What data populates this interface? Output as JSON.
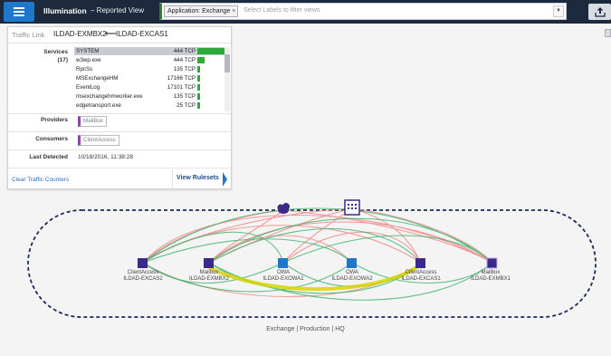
{
  "header": {
    "app_title": "Illumination",
    "view_title": "–  Reported View",
    "filter_chip": "Application: Exchange",
    "filter_chip_close": "×",
    "filter_placeholder": "Select Labels to filter views",
    "dropdown_glyph": "▼",
    "icons": [
      "menu-icon",
      "export-icon"
    ]
  },
  "panel": {
    "header_label": "Traffic Link",
    "source": "ILDAD-EXMBX2",
    "arrow": "⟵",
    "destination": "ILDAD-EXCAS1",
    "services_label": "Services",
    "services_count": "(17)",
    "services": [
      {
        "name": "SYSTEM",
        "count": "444 TCP",
        "bar": 1.0
      },
      {
        "name": "w3wp.exe",
        "count": "444 TCP",
        "bar": 0.28
      },
      {
        "name": "RpcSs",
        "count": "135 TCP",
        "bar": 0.09
      },
      {
        "name": "MSExchangeHM",
        "count": "17166 TCP",
        "bar": 0.09
      },
      {
        "name": "EventLog",
        "count": "17101 TCP",
        "bar": 0.09
      },
      {
        "name": "msexchangehmworker.exe",
        "count": "135 TCP",
        "bar": 0.09
      },
      {
        "name": "edgetransport.exe",
        "count": "25 TCP",
        "bar": 0.09
      }
    ],
    "providers_label": "Providers",
    "provider": "MailBox",
    "consumers_label": "Consumers",
    "consumer": "ClientAccess",
    "last_detected_label": "Last Detected",
    "last_detected": "10/18/2016, 11:38:28",
    "clear_link": "Clear Traffic Counters",
    "view_rulesets": "View Rulesets"
  },
  "graph": {
    "group_label": "Exchange | Production | HQ",
    "nodes": [
      {
        "role": "ClientAccess",
        "name": "ILDAD-EXCAS2",
        "color": "#3b2a8a"
      },
      {
        "role": "Mailbox",
        "name": "ILDAD-EXMBX2",
        "color": "#3b2a8a"
      },
      {
        "role": "OWA",
        "name": "ILDAD-EXOWA1",
        "color": "#1f77c9"
      },
      {
        "role": "OWA",
        "name": "ILDAD-EXOWA2",
        "color": "#1f77c9"
      },
      {
        "role": "ClientAccess",
        "name": "ILDAD-EXCAS1",
        "color": "#3b2a8a"
      },
      {
        "role": "Mailbox",
        "name": "ILDAD-EXMBX1",
        "color": "#3b2a8a"
      }
    ],
    "external_icons": [
      "cloud-icon",
      "datacenter-icon"
    ],
    "colors": {
      "allowed": "#2eaa3c",
      "blocked": "#f08080",
      "selected": "#d8d400"
    }
  }
}
